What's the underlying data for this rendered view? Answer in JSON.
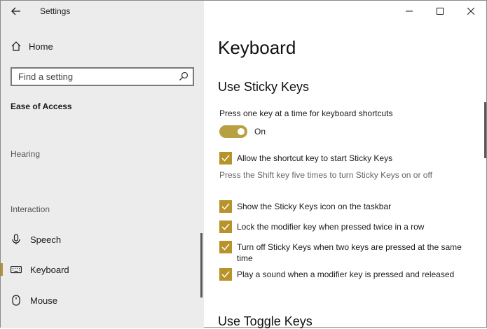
{
  "window": {
    "app_title": "Settings"
  },
  "sidebar": {
    "home_label": "Home",
    "search": {
      "placeholder": "Find a setting"
    },
    "section_title": "Ease of Access",
    "groups": [
      {
        "label": "Hearing"
      },
      {
        "label": "Interaction"
      }
    ],
    "items": [
      {
        "label": "Speech",
        "icon": "microphone-icon",
        "selected": false
      },
      {
        "label": "Keyboard",
        "icon": "keyboard-icon",
        "selected": true
      },
      {
        "label": "Mouse",
        "icon": "mouse-icon",
        "selected": false
      }
    ]
  },
  "main": {
    "page_title": "Keyboard",
    "sticky": {
      "heading": "Use Sticky Keys",
      "description": "Press one key at a time for keyboard shortcuts",
      "toggle_state": "On",
      "options": [
        {
          "label": "Allow the shortcut key to start Sticky Keys",
          "checked": true
        },
        {
          "label": "Show the Sticky Keys icon on the taskbar",
          "checked": true
        },
        {
          "label": "Lock the modifier key when pressed twice in a row",
          "checked": true
        },
        {
          "label": "Turn off Sticky Keys when two keys are pressed at the same time",
          "checked": true
        },
        {
          "label": "Play a sound when a modifier key is pressed and released",
          "checked": true
        }
      ],
      "hint": "Press the Shift key five times to turn Sticky Keys on or off"
    },
    "toggle_keys": {
      "heading": "Use Toggle Keys"
    }
  },
  "colors": {
    "accent": "#b8932a",
    "sidebar_bg": "#ececec"
  }
}
